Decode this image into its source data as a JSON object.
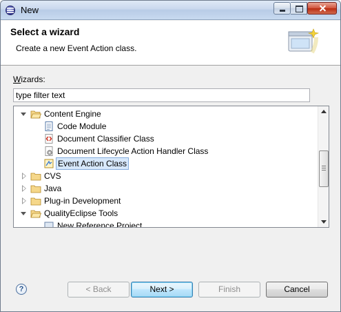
{
  "window": {
    "title": "New"
  },
  "banner": {
    "title": "Select a wizard",
    "description": "Create a new Event Action class."
  },
  "wizards": {
    "label_prefix": "W",
    "label_rest": "izards:",
    "filter_value": "type filter text"
  },
  "tree": {
    "items": [
      {
        "label": "Content Engine",
        "expanded": true,
        "icon": "folder-open-icon"
      },
      {
        "label": "Code Module",
        "icon": "code-module-icon"
      },
      {
        "label": "Document Classifier Class",
        "icon": "classifier-icon"
      },
      {
        "label": "Document Lifecycle Action Handler Class",
        "icon": "lifecycle-icon"
      },
      {
        "label": "Event Action Class",
        "icon": "event-action-icon",
        "selected": true
      },
      {
        "label": "CVS",
        "expanded": false,
        "icon": "folder-icon"
      },
      {
        "label": "Java",
        "expanded": false,
        "icon": "folder-icon"
      },
      {
        "label": "Plug-in Development",
        "expanded": false,
        "icon": "folder-icon"
      },
      {
        "label": "QualityEclipse Tools",
        "expanded": true,
        "icon": "folder-open-icon"
      },
      {
        "label": "New Reference Project",
        "icon": "project-icon"
      }
    ]
  },
  "buttons": {
    "help": "?",
    "back": "< Back",
    "next": "Next >",
    "finish": "Finish",
    "cancel": "Cancel"
  }
}
